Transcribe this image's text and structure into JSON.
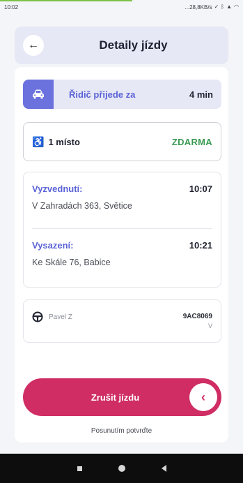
{
  "status_bar": {
    "time": "10:02",
    "net_speed": "...28,8KB/s",
    "icons": [
      "check-icon",
      "bluetooth-icon",
      "signal-icon",
      "wifi-icon"
    ]
  },
  "header": {
    "title": "Detaily jízdy",
    "back_icon": "arrow-left-icon"
  },
  "eta": {
    "icon": "car-icon",
    "label": "Řidič přijede za",
    "time": "4 min"
  },
  "seat": {
    "icon": "wheelchair-icon",
    "label": "1 místo",
    "price": "ZDARMA"
  },
  "route": {
    "pickup": {
      "label": "Vyzvednutí:",
      "time": "10:07",
      "address": "V Zahradách 363, Světice"
    },
    "dropoff": {
      "label": "Vysazení:",
      "time": "10:21",
      "address": "Ke Skále 76, Babice"
    }
  },
  "driver": {
    "icon": "steering-wheel-icon",
    "name": "Pavel Z",
    "plate": "9AC8069",
    "plate_sub": "V"
  },
  "cancel": {
    "label": "Zrušit jízdu",
    "hint": "Posunutím potvrďte",
    "knob_icon": "chevron-left-icon"
  },
  "colors": {
    "accent": "#5a63d6",
    "accent_bg": "#e6e8f6",
    "success": "#3a9a52",
    "danger": "#cf2d63"
  }
}
